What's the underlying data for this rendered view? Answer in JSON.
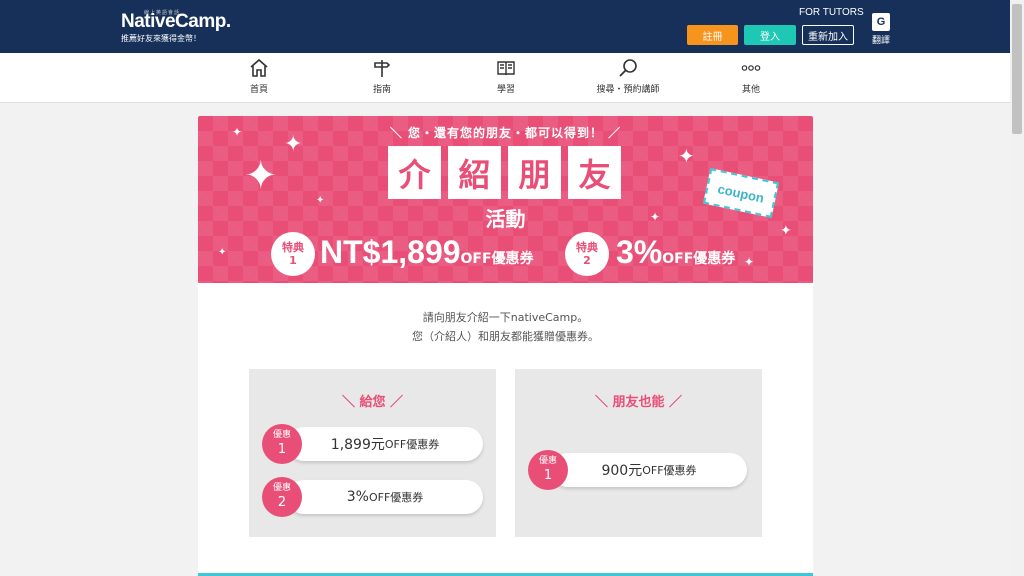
{
  "header": {
    "logo_tag": "線上英語會話",
    "logo_native": "Native",
    "logo_camp": "Camp.",
    "tagline": "推薦好友來獲得金幣！",
    "for_tutors": "FOR TUTORS",
    "register_label": "註冊",
    "login_label": "登入",
    "rejoin_label": "重新加入",
    "translate_label": "翻譯",
    "translate_icon_text": "G"
  },
  "nav": [
    {
      "label": "首頁",
      "icon": "home-icon"
    },
    {
      "label": "指南",
      "icon": "signpost-icon"
    },
    {
      "label": "學習",
      "icon": "book-icon"
    },
    {
      "label": "搜尋・預約講師",
      "icon": "search-icon"
    },
    {
      "label": "其他",
      "icon": "more-icon"
    }
  ],
  "banner": {
    "top_text": "＼ 您・還有您的朋友・都可以得到！ ／",
    "title_chars": [
      "介",
      "紹",
      "朋",
      "友"
    ],
    "subtitle": "活動",
    "perks": [
      {
        "badge_label": "特典",
        "badge_num": "1",
        "value": "NT$1,899",
        "suffix": "OFF優惠券"
      },
      {
        "badge_label": "特典",
        "badge_num": "2",
        "value": "3%",
        "suffix": "OFF優惠券"
      }
    ],
    "coupon_label": "coupon"
  },
  "intro": {
    "line1": "請向朋友介紹一下nativeCamp。",
    "line2": "您（介紹人）和朋友都能獲贈優惠券。"
  },
  "panels": {
    "left": {
      "title": "＼ 給您 ／",
      "items": [
        {
          "badge_label": "優惠",
          "badge_num": "1",
          "value": "1,899元",
          "suffix": "OFF優惠券"
        },
        {
          "badge_label": "優惠",
          "badge_num": "2",
          "value": "3%",
          "suffix": "OFF優惠券"
        }
      ]
    },
    "right": {
      "title": "＼ 朋友也能 ／",
      "items": [
        {
          "badge_label": "優惠",
          "badge_num": "1",
          "value": "900元",
          "suffix": "OFF優惠券"
        }
      ]
    }
  },
  "colors": {
    "header_bg": "#16305a",
    "accent_pink": "#e94e77",
    "register_orange": "#f7941d",
    "login_teal": "#1ec8b4"
  }
}
